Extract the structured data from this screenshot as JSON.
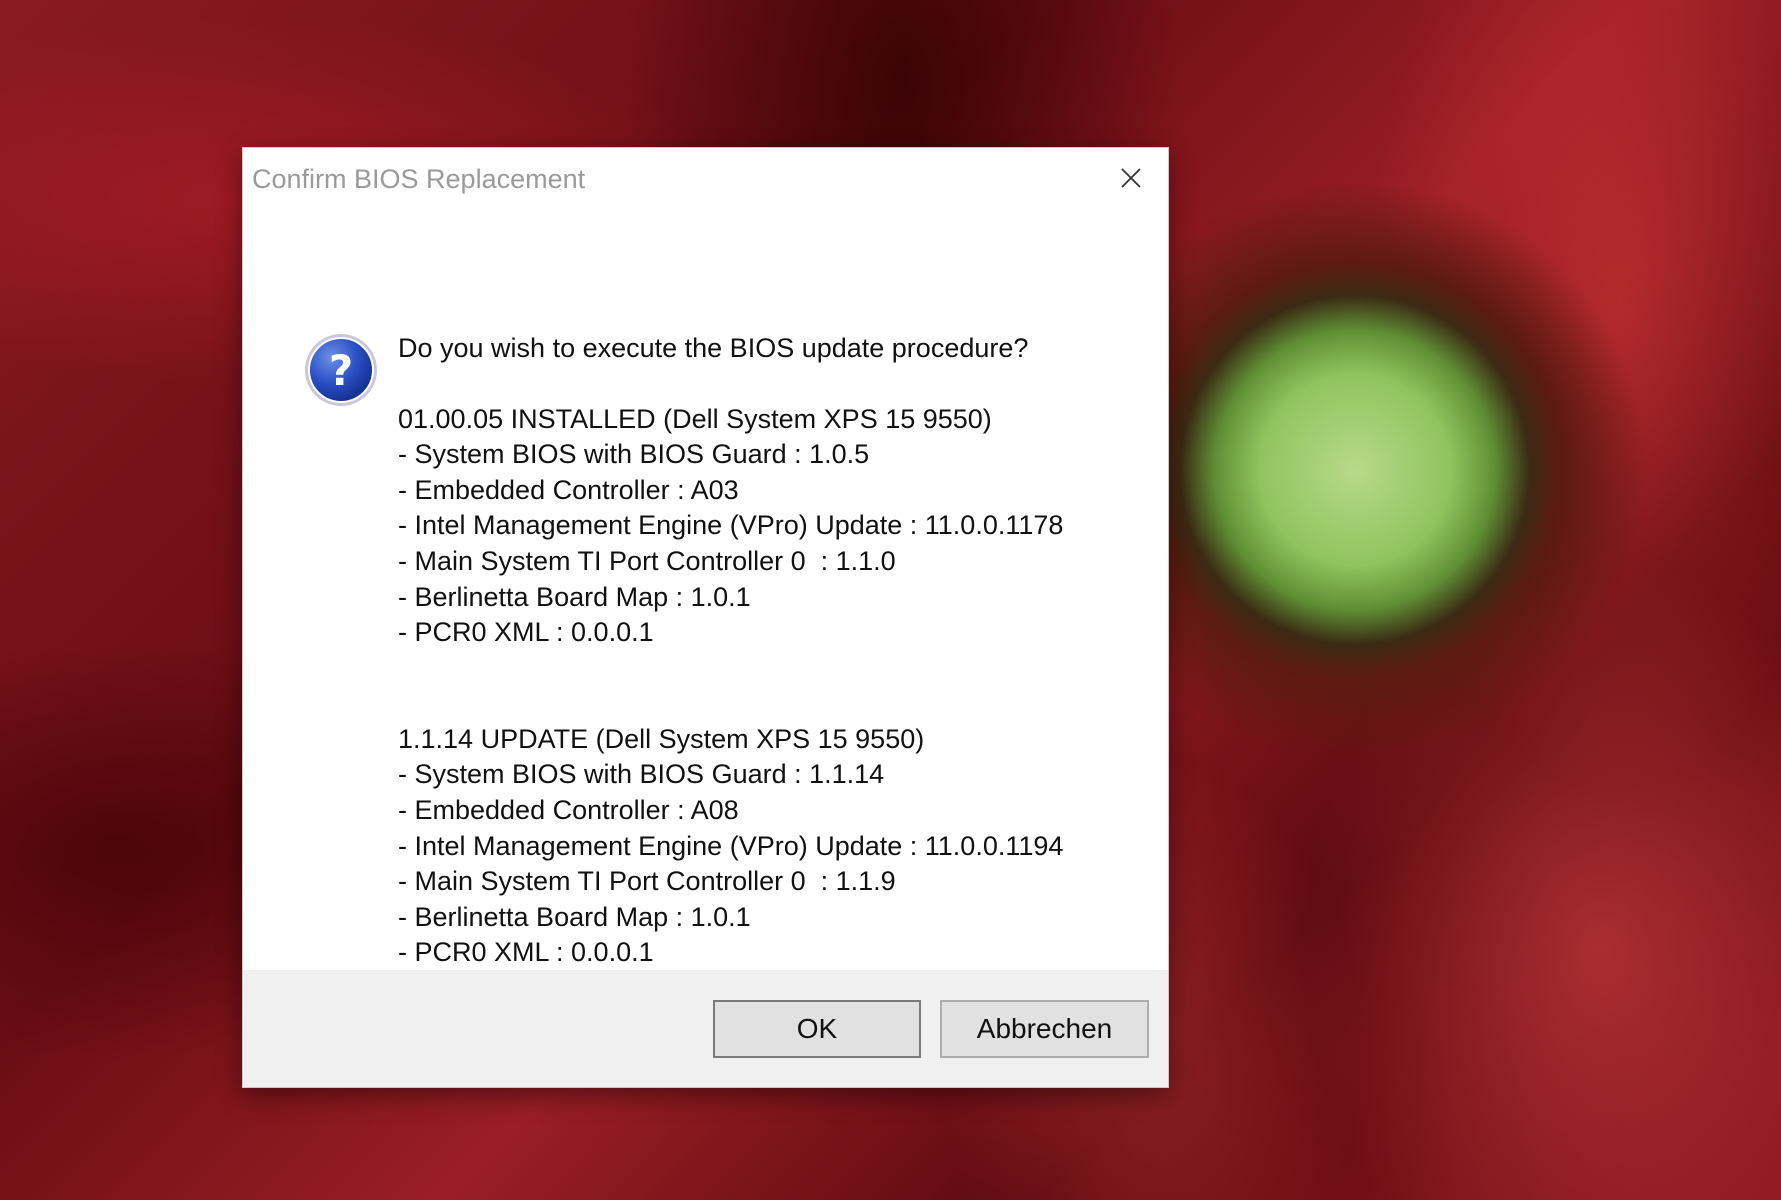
{
  "dialog": {
    "title": "Confirm BIOS Replacement",
    "close_icon": "close-icon",
    "question_icon": "question-icon",
    "question": "Do you wish to execute the BIOS update procedure?",
    "installed": {
      "header": "01.00.05 INSTALLED (Dell System XPS 15 9550)",
      "items": [
        "- System BIOS with BIOS Guard : 1.0.5",
        "- Embedded Controller : A03",
        "- Intel Management Engine (VPro) Update : 11.0.0.1178",
        "- Main System TI Port Controller 0  : 1.1.0",
        "- Berlinetta Board Map : 1.0.1",
        "- PCR0 XML : 0.0.0.1"
      ]
    },
    "update": {
      "header": "1.1.14 UPDATE (Dell System XPS 15 9550)",
      "items": [
        "- System BIOS with BIOS Guard : 1.1.14",
        "- Embedded Controller : A08",
        "- Intel Management Engine (VPro) Update : 11.0.0.1194",
        "- Main System TI Port Controller 0  : 1.1.9",
        "- Berlinetta Board Map : 1.0.1",
        "- PCR0 XML : 0.0.0.1"
      ]
    },
    "buttons": {
      "ok_label": "OK",
      "cancel_label": "Abbrechen"
    }
  }
}
